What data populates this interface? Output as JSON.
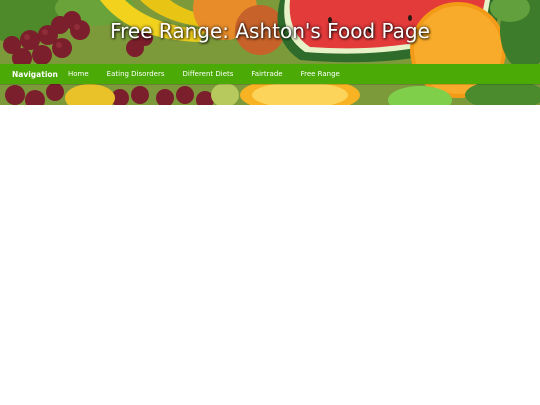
{
  "header": {
    "title": "Free Range: Ashton's Food Page",
    "banner_image": "fruit-and-vegetables-photo"
  },
  "navbar": {
    "brand": "Navigation",
    "links": [
      {
        "label": "Home"
      },
      {
        "label": "Eating Disorders"
      },
      {
        "label": "Different Diets"
      },
      {
        "label": "Fairtrade"
      },
      {
        "label": "Free Range"
      }
    ]
  },
  "colors": {
    "navbar_background": "#4caa06",
    "title_text": "#ffffff",
    "page_background": "#ffffff"
  }
}
